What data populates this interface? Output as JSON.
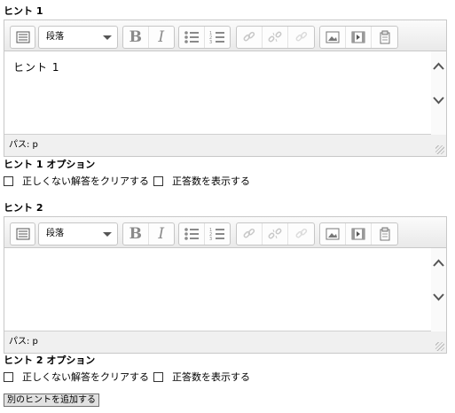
{
  "hints": [
    {
      "title": "ヒント 1",
      "format": "段落",
      "content": "ヒント 1",
      "status": "パス: p",
      "options_title": "ヒント 1 オプション",
      "opt_clear": "正しくない解答をクリアする",
      "opt_show": "正答数を表示する"
    },
    {
      "title": "ヒント 2",
      "format": "段落",
      "content": "",
      "status": "パス: p",
      "options_title": "ヒント 2 オプション",
      "opt_clear": "正しくない解答をクリアする",
      "opt_show": "正答数を表示する"
    }
  ],
  "add_hint_button": "別のヒントを追加する",
  "toolbar_icons": [
    "toolbar-toggle-icon",
    "bold-icon",
    "italic-icon",
    "bullet-list-icon",
    "numbered-list-icon",
    "link-icon",
    "unlink-icon",
    "anchor-icon",
    "image-icon",
    "media-icon",
    "manage-files-icon"
  ],
  "colors": {
    "toolbar_border": "#c6c6c6",
    "editor_bg": "#f0f0f0",
    "icon_gray": "#8a8a8a"
  }
}
